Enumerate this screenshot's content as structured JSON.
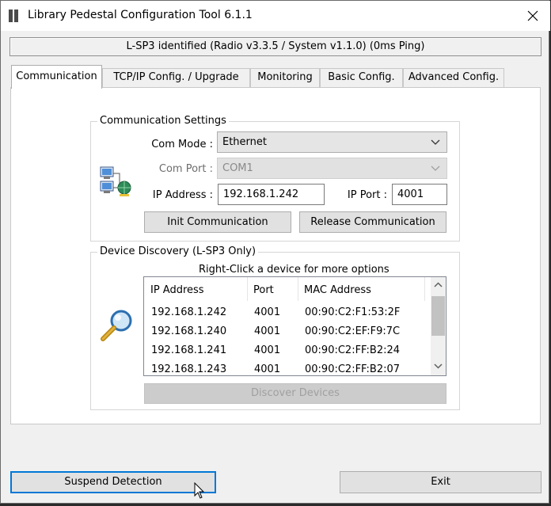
{
  "window": {
    "title": "Library Pedestal Configuration Tool 6.1.1",
    "status": "L-SP3 identified (Radio v3.3.5 / System v1.1.0) (0ms Ping)"
  },
  "tabs": [
    {
      "label": "Communication"
    },
    {
      "label": "TCP/IP Config. / Upgrade"
    },
    {
      "label": "Monitoring"
    },
    {
      "label": "Basic Config."
    },
    {
      "label": "Advanced Config."
    }
  ],
  "comm_settings": {
    "title": "Communication Settings",
    "com_mode_label": "Com Mode :",
    "com_mode_value": "Ethernet",
    "com_port_label": "Com Port :",
    "com_port_value": "COM1",
    "ip_address_label": "IP Address :",
    "ip_address_value": "192.168.1.242",
    "ip_port_label": "IP Port :",
    "ip_port_value": "4001",
    "init_button": "Init Communication",
    "release_button": "Release Communication"
  },
  "discovery": {
    "title": "Device Discovery (L-SP3 Only)",
    "hint": "Right-Click a device for more options",
    "columns": [
      "IP Address",
      "Port",
      "MAC Address"
    ],
    "rows": [
      [
        "192.168.1.242",
        "4001",
        "00:90:C2:F1:53:2F"
      ],
      [
        "192.168.1.240",
        "4001",
        "00:90:C2:EF:F9:7C"
      ],
      [
        "192.168.1.241",
        "4001",
        "00:90:C2:FF:B2:24"
      ],
      [
        "192.168.1.243",
        "4001",
        "00:90:C2:FF:B2:07"
      ]
    ],
    "discover_button": "Discover Devices"
  },
  "footer": {
    "suspend_button": "Suspend Detection",
    "exit_button": "Exit"
  },
  "icons": {
    "network": "network-computers-icon",
    "search": "magnifier-icon",
    "close": "close-icon",
    "dropdown": "chevron-down-icon"
  },
  "colors": {
    "focus_border": "#0078d7",
    "window_bg": "#f0f0f0",
    "panel_bg": "#ffffff"
  }
}
